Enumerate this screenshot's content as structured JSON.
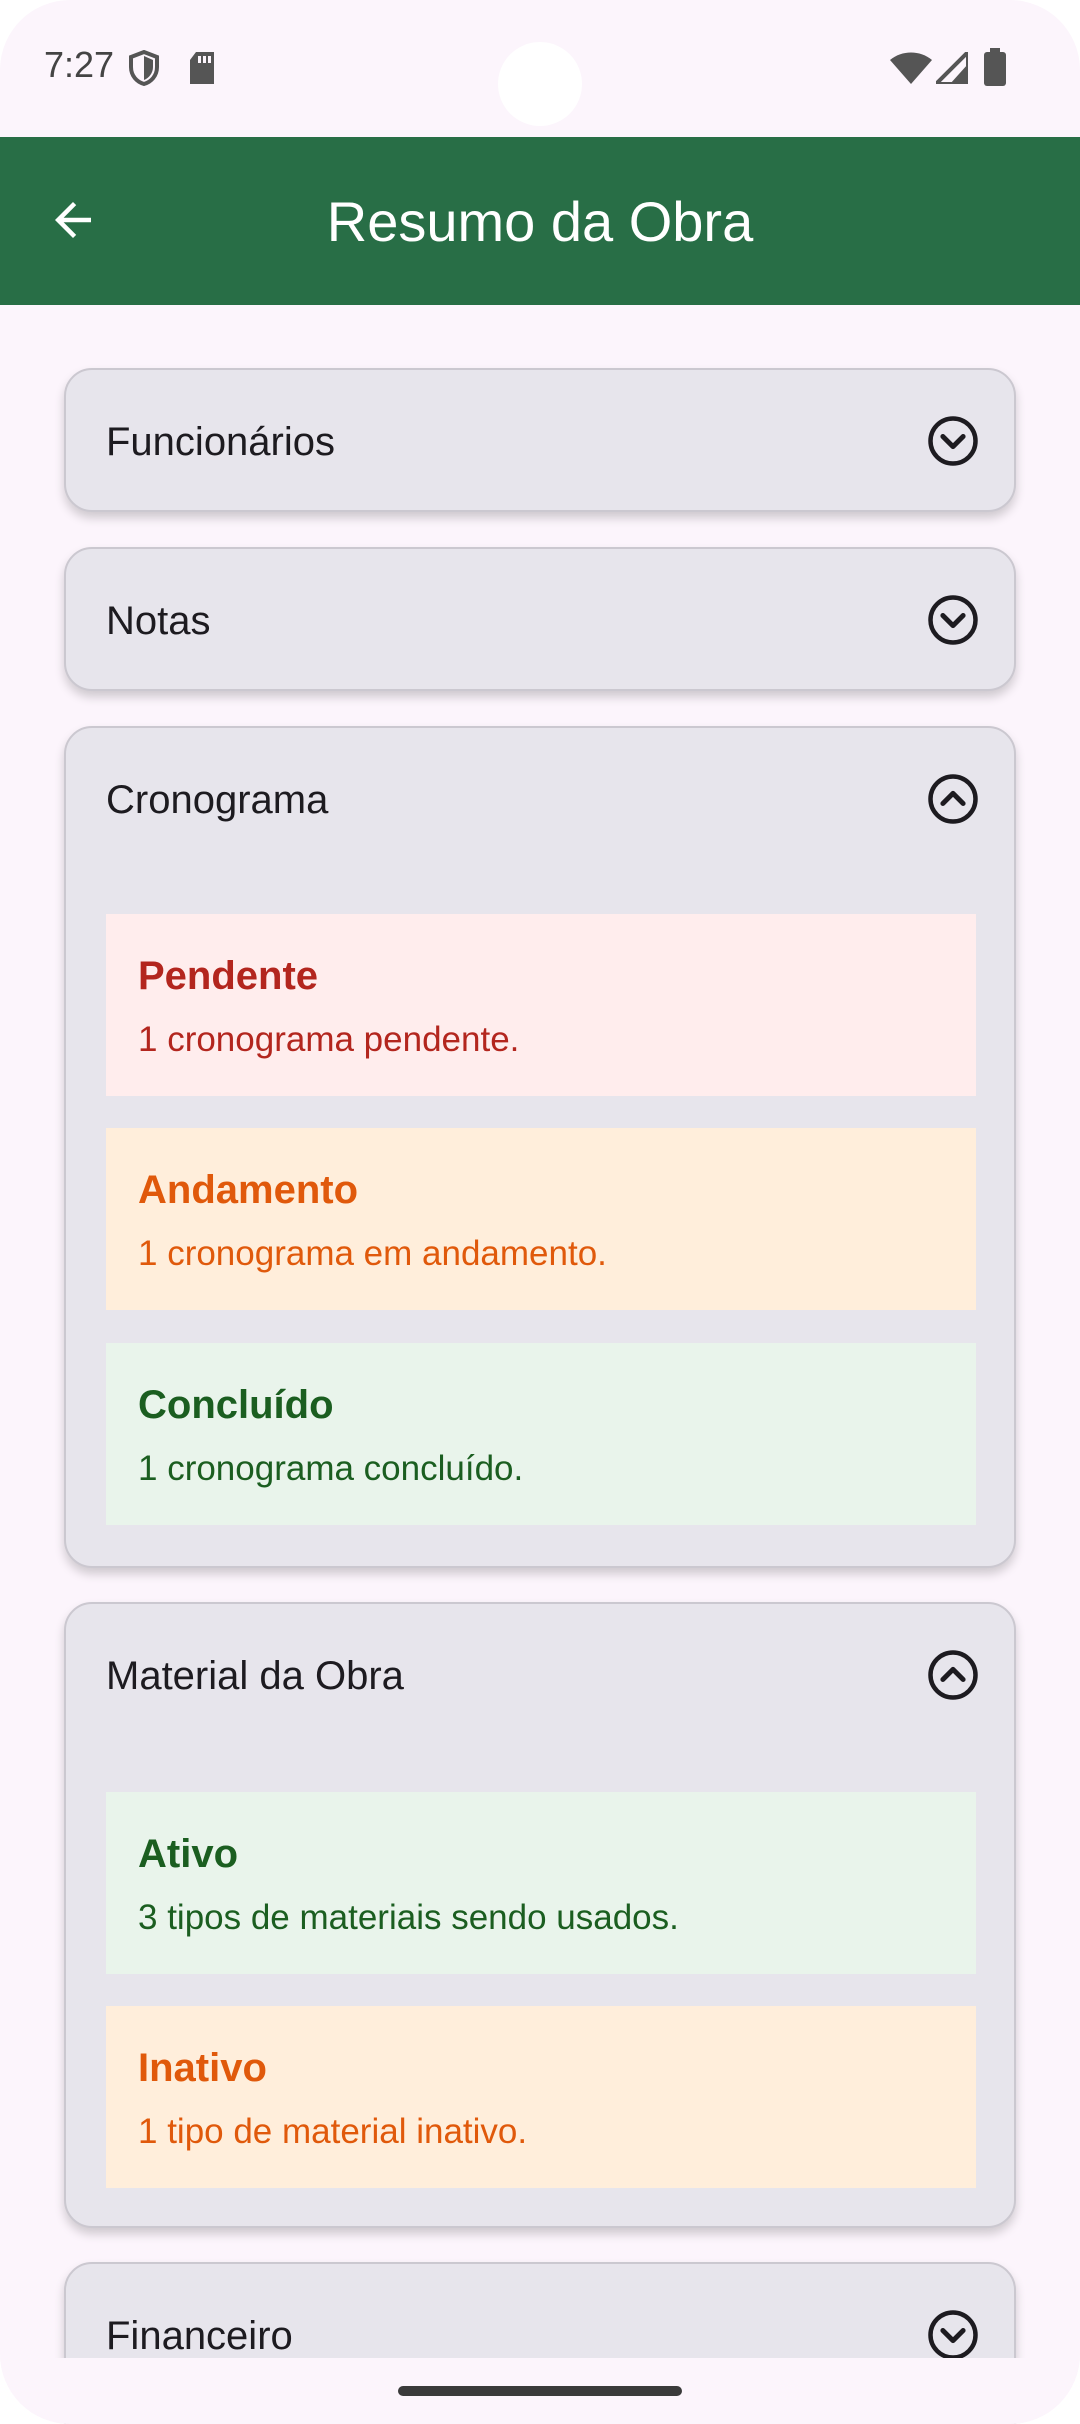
{
  "status_bar": {
    "time": "7:27",
    "icons": [
      "shield-icon",
      "sd-card-icon",
      "wifi-icon",
      "signal-icon",
      "battery-icon"
    ]
  },
  "app_bar": {
    "title": "Resumo da Obra",
    "back_icon": "arrow-back-icon",
    "color": "#286e46"
  },
  "sections": [
    {
      "title": "Funcionários",
      "expanded": false
    },
    {
      "title": "Notas",
      "expanded": false
    },
    {
      "title": "Cronograma",
      "expanded": true,
      "items": [
        {
          "title": "Pendente",
          "description": "1 cronograma pendente.",
          "status": "red"
        },
        {
          "title": "Andamento",
          "description": "1 cronograma em andamento.",
          "status": "orange"
        },
        {
          "title": "Concluído",
          "description": "1 cronograma concluído.",
          "status": "green"
        }
      ]
    },
    {
      "title": "Material da Obra",
      "expanded": true,
      "items": [
        {
          "title": "Ativo",
          "description": "3 tipos de materiais sendo usados.",
          "status": "green"
        },
        {
          "title": "Inativo",
          "description": "1 tipo de material inativo.",
          "status": "orange"
        }
      ]
    },
    {
      "title": "Financeiro",
      "expanded": false
    }
  ],
  "colors": {
    "red": "#b3261e",
    "orange": "#e0590b",
    "green": "#1b5e20"
  }
}
